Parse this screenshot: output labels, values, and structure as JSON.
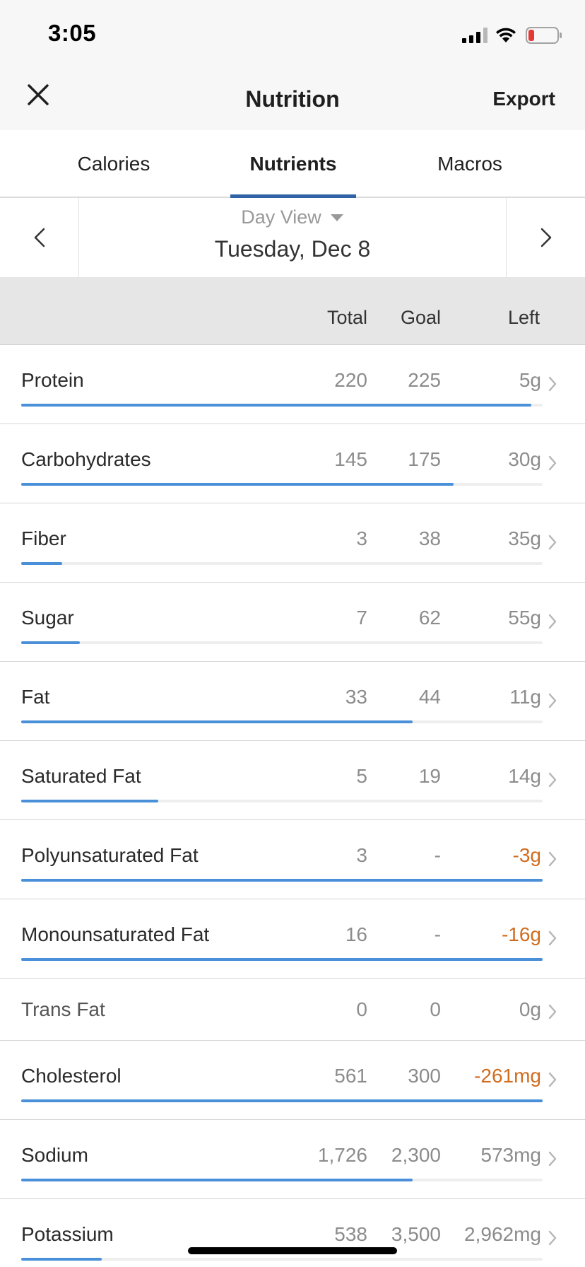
{
  "status_bar": {
    "time": "3:05"
  },
  "nav": {
    "title": "Nutrition",
    "export_label": "Export"
  },
  "tabs": [
    {
      "label": "Calories",
      "active": false
    },
    {
      "label": "Nutrients",
      "active": true
    },
    {
      "label": "Macros",
      "active": false
    }
  ],
  "date_selector": {
    "view_label": "Day View",
    "date": "Tuesday, Dec 8"
  },
  "table_header": {
    "total": "Total",
    "goal": "Goal",
    "left": "Left"
  },
  "rows": [
    {
      "name": "Protein",
      "total": "220",
      "goal": "225",
      "left": "5g",
      "over": false,
      "progress": 0.978
    },
    {
      "name": "Carbohydrates",
      "total": "145",
      "goal": "175",
      "left": "30g",
      "over": false,
      "progress": 0.829
    },
    {
      "name": "Fiber",
      "total": "3",
      "goal": "38",
      "left": "35g",
      "over": false,
      "progress": 0.079
    },
    {
      "name": "Sugar",
      "total": "7",
      "goal": "62",
      "left": "55g",
      "over": false,
      "progress": 0.113
    },
    {
      "name": "Fat",
      "total": "33",
      "goal": "44",
      "left": "11g",
      "over": false,
      "progress": 0.75
    },
    {
      "name": "Saturated Fat",
      "total": "5",
      "goal": "19",
      "left": "14g",
      "over": false,
      "progress": 0.263
    },
    {
      "name": "Polyunsaturated Fat",
      "total": "3",
      "goal": "-",
      "left": "-3g",
      "over": true,
      "progress": 1.0
    },
    {
      "name": "Monounsaturated Fat",
      "total": "16",
      "goal": "-",
      "left": "-16g",
      "over": true,
      "progress": 1.0
    },
    {
      "name": "Trans Fat",
      "total": "0",
      "goal": "0",
      "left": "0g",
      "over": false,
      "progress": null
    },
    {
      "name": "Cholesterol",
      "total": "561",
      "goal": "300",
      "left": "-261mg",
      "over": true,
      "progress": 1.0
    },
    {
      "name": "Sodium",
      "total": "1,726",
      "goal": "2,300",
      "left": "573mg",
      "over": false,
      "progress": 0.75
    },
    {
      "name": "Potassium",
      "total": "538",
      "goal": "3,500",
      "left": "2,962mg",
      "over": false,
      "progress": 0.154
    }
  ],
  "colors": {
    "accent_blue": "#4a90d9",
    "tab_indicator": "#3063a5",
    "over_goal": "#d16c1f",
    "header_bg": "#e6e6e6",
    "nav_bg": "#f7f7f7"
  },
  "icons": {
    "close": "close-icon",
    "prev": "chevron-left-icon",
    "next": "chevron-right-icon",
    "dropdown": "caret-down-icon",
    "row_chevron": "chevron-right-icon"
  }
}
